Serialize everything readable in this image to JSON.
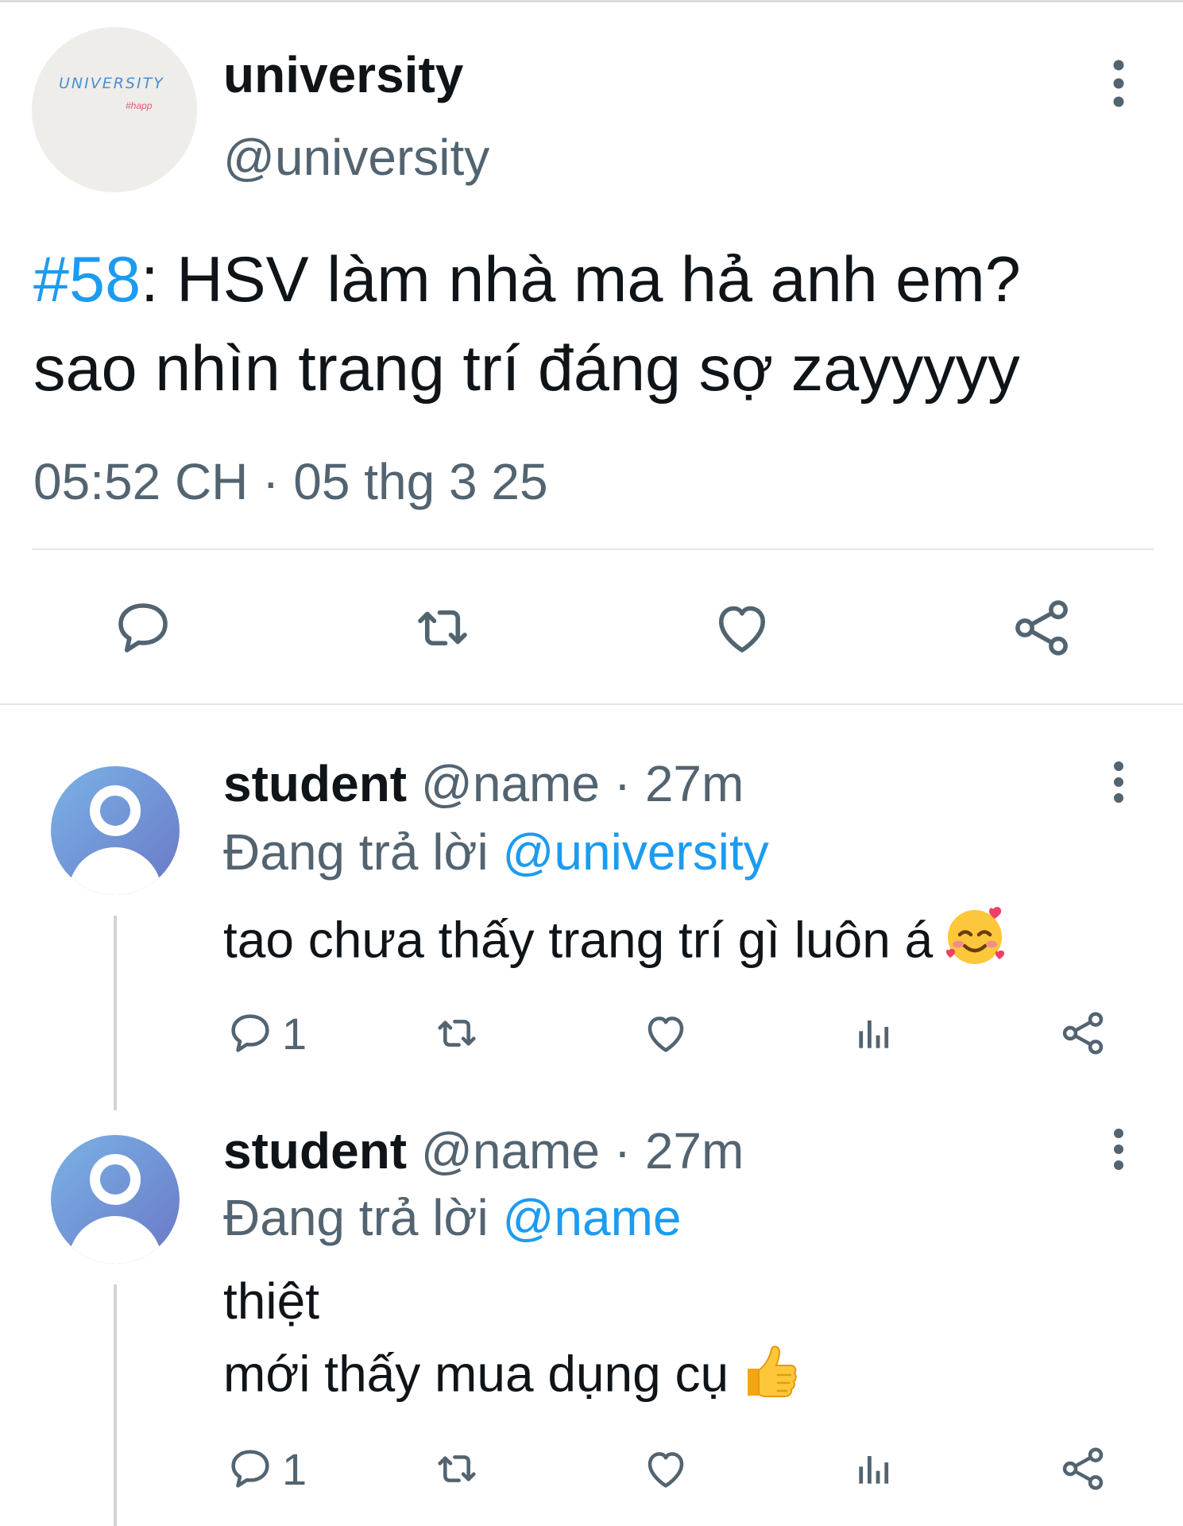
{
  "main": {
    "avatar_text": "UNIVERSITY",
    "avatar_subtext": "#happ",
    "name": "university",
    "handle": "@university",
    "hashtag": "#58",
    "text_line1_rest": ": HSV làm nhà ma hả anh em?",
    "text_line2": "sao nhìn trang trí đáng sợ zayyyyy",
    "timestamp": "05:52 CH · 05 thg 3 25",
    "actions": [
      "reply-icon",
      "retweet-icon",
      "like-icon",
      "share-icon"
    ]
  },
  "replies": [
    {
      "name": "student",
      "handle": "@name",
      "time": "· 27m",
      "replying_prefix": "Đang trả lời",
      "replying_to": "@university",
      "text_lines": [
        "tao chưa thấy trang trí gì luôn á"
      ],
      "emoji": "smiling-face-with-hearts-icon",
      "reply_count": "1"
    },
    {
      "name": "student",
      "handle": "@name",
      "time": "· 27m",
      "replying_prefix": "Đang trả lời",
      "replying_to": "@name",
      "text_lines": [
        "thiệt",
        "mới thấy mua dụng cụ"
      ],
      "emoji": "thumbs-up-icon",
      "reply_count": "1"
    }
  ],
  "colors": {
    "accent": "#1d9bf0",
    "muted": "#536471",
    "text": "#0f1419",
    "avatar_gradient": [
      "#7ab2e6",
      "#6a78c6"
    ]
  }
}
